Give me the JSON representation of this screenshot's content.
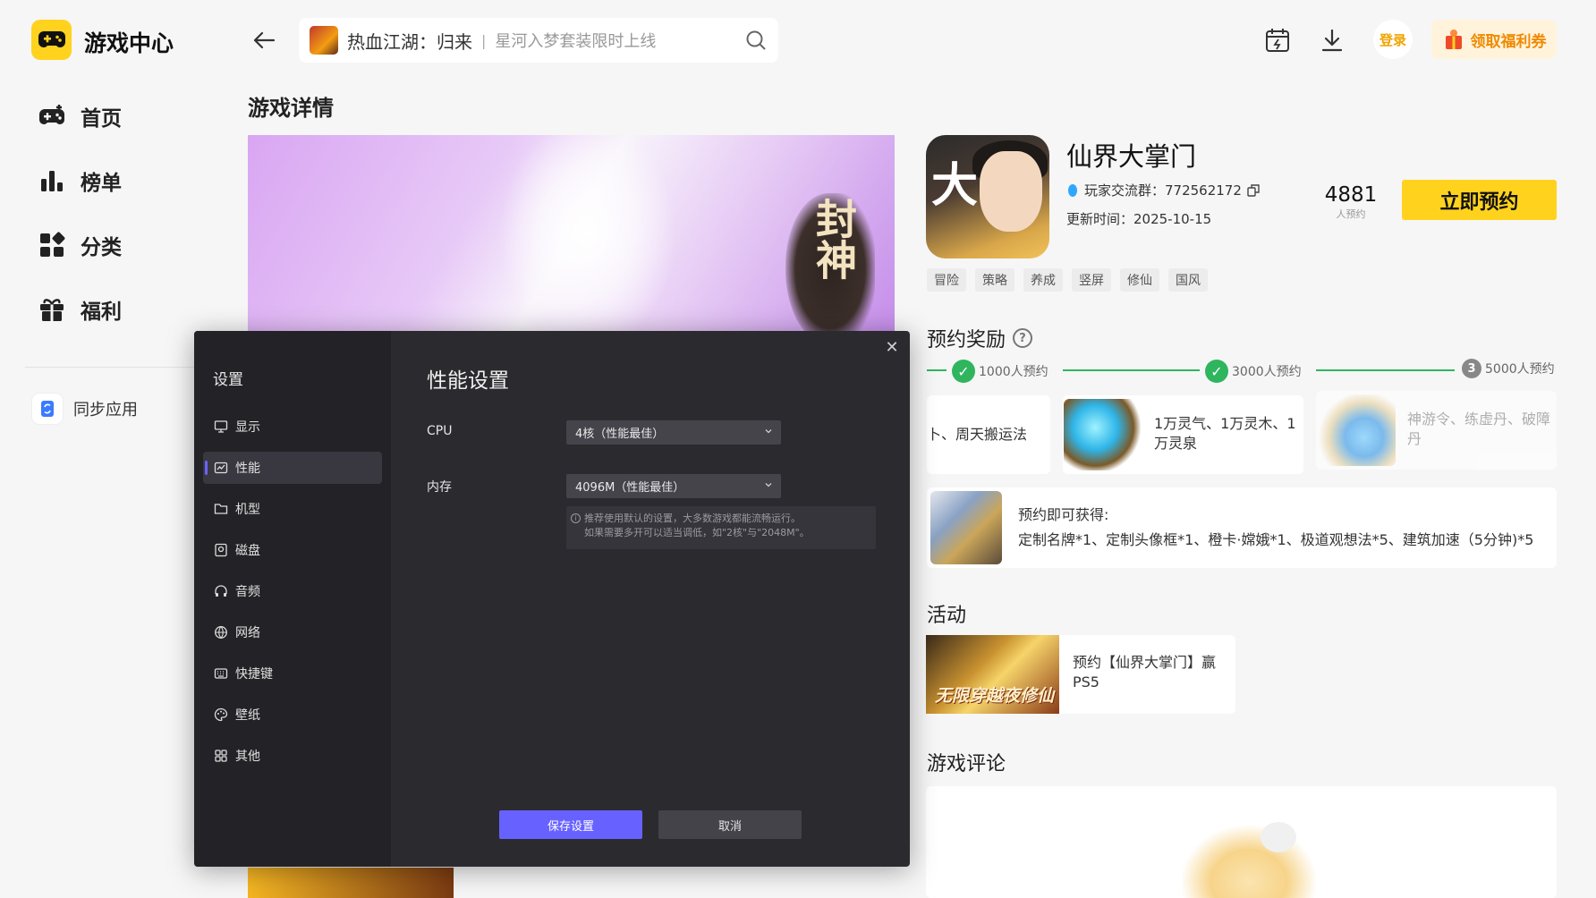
{
  "app": {
    "title": "游戏中心"
  },
  "sidebar": {
    "items": [
      {
        "label": "首页",
        "icon": "gamepad-icon"
      },
      {
        "label": "榜单",
        "icon": "ranking-icon"
      },
      {
        "label": "分类",
        "icon": "category-icon"
      },
      {
        "label": "福利",
        "icon": "gift-icon"
      }
    ],
    "sync_label": "同步应用"
  },
  "topbar": {
    "search_hot": "热血江湖：归来",
    "search_sep": "|",
    "search_sub": "星河入梦套装限时上线",
    "login_label": "登录",
    "coupon_label": "领取福利券"
  },
  "page": {
    "title": "游戏详情"
  },
  "banner": {
    "text": "封神"
  },
  "game": {
    "name": "仙界大掌门",
    "icon_glyph": "大",
    "group": "玩家交流群：772562172",
    "update": "更新时间：2025-10-15",
    "reserve_count": "4881",
    "reserve_unit": "人预约",
    "reserve_button": "立即预约",
    "tags": [
      "冒险",
      "策略",
      "养成",
      "竖屏",
      "修仙",
      "国风"
    ]
  },
  "rewards": {
    "title": "预约奖励",
    "milestones": [
      {
        "label": "1000人预约",
        "done": true
      },
      {
        "label": "3000人预约",
        "done": true
      },
      {
        "label": "5000人预约",
        "done": false,
        "step": "3"
      }
    ],
    "cards": [
      "卜、周天搬运法",
      "1万灵气、1万灵木、1万灵泉",
      "神游令、练虚丹、破障丹"
    ],
    "bonus_title": "预约即可获得:",
    "bonus_items": "定制名牌*1、定制头像框*1、橙卡·嫦娥*1、极道观想法*5、建筑加速（5分钟)*5"
  },
  "activity": {
    "title": "活动",
    "card_text": "预约【仙界大掌门】赢PS5",
    "image_text": "无限穿越夜修仙"
  },
  "reviews": {
    "title": "游戏评论"
  },
  "dialog": {
    "side_title": "设置",
    "items": [
      {
        "label": "显示",
        "icon": "monitor-icon"
      },
      {
        "label": "性能",
        "icon": "performance-icon"
      },
      {
        "label": "机型",
        "icon": "folder-icon"
      },
      {
        "label": "磁盘",
        "icon": "disk-icon"
      },
      {
        "label": "音频",
        "icon": "audio-icon"
      },
      {
        "label": "网络",
        "icon": "globe-icon"
      },
      {
        "label": "快捷键",
        "icon": "keyboard-icon"
      },
      {
        "label": "壁纸",
        "icon": "palette-icon"
      },
      {
        "label": "其他",
        "icon": "grid-icon"
      }
    ],
    "active_index": 1,
    "heading": "性能设置",
    "cpu_label": "CPU",
    "cpu_value": "4核（性能最佳）",
    "memory_label": "内存",
    "memory_value": "4096M（性能最佳）",
    "hint_line1": "推荐使用默认的设置，大多数游戏都能流畅运行。",
    "hint_line2": "如果需要多开可以适当调低，如\"2核\"与\"2048M\"。",
    "save_label": "保存设置",
    "cancel_label": "取消"
  },
  "colors": {
    "accent_yellow": "#ffd21e",
    "success_green": "#2fb55e",
    "dialog_primary": "#6762ff"
  }
}
